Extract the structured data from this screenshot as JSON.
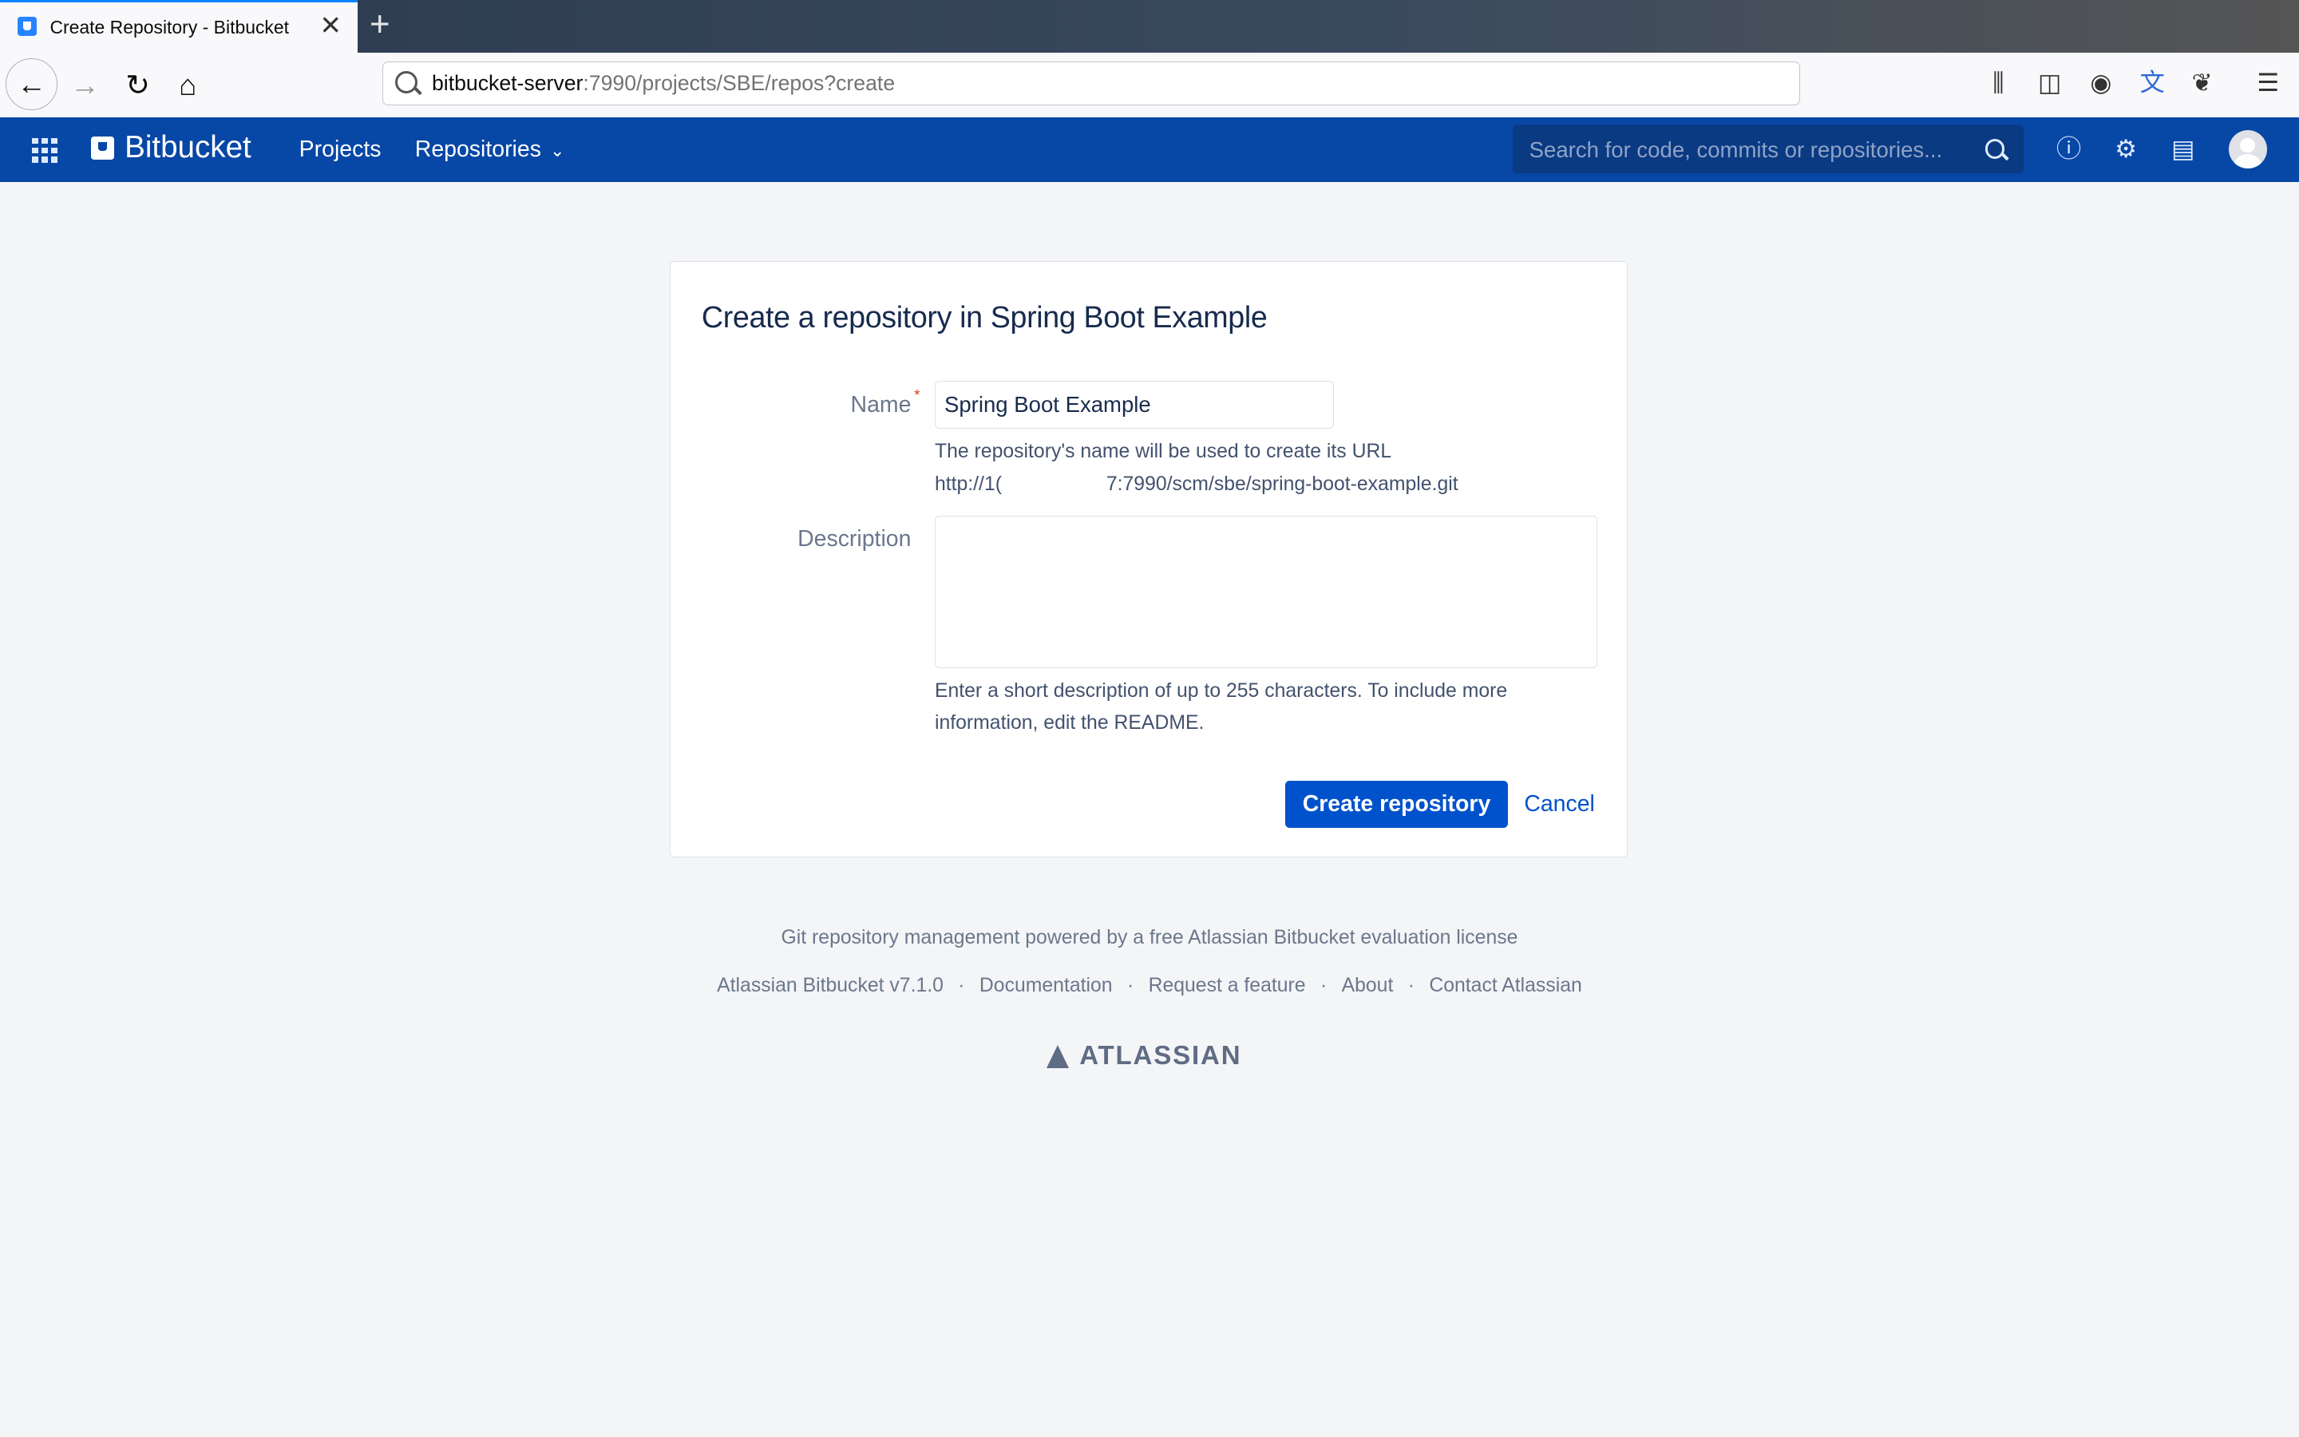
{
  "browser": {
    "tab_title": "Create Repository - Bitbucket",
    "url_host": "bitbucket-server",
    "url_rest": ":7990/projects/SBE/repos?create"
  },
  "appnav": {
    "brand": "Bitbucket",
    "projects": "Projects",
    "repositories": "Repositories",
    "search_placeholder": "Search for code, commits or repositories..."
  },
  "form": {
    "title": "Create a repository in Spring Boot Example",
    "name_label": "Name",
    "name_value": "Spring Boot Example",
    "name_help": "The repository's name will be used to create its URL",
    "url_prefix": "http://1(",
    "url_suffix": "7:7990/scm/sbe/spring-boot-example.git",
    "description_label": "Description",
    "description_value": "",
    "description_help_1": "Enter a short description of up to 255 characters. To include more",
    "description_help_2": "information, edit the README.",
    "create_button": "Create repository",
    "cancel_link": "Cancel"
  },
  "footer": {
    "license": "Git repository management powered by a free Atlassian Bitbucket evaluation license",
    "version": "Atlassian Bitbucket v7.1.0",
    "documentation": "Documentation",
    "request_feature": "Request a feature",
    "about": "About",
    "contact": "Contact Atlassian",
    "atlassian": "ATLASSIAN"
  },
  "colors": {
    "nav_bg": "#0747a6",
    "primary_button": "#0052cc",
    "page_bg": "#f4f5f7"
  }
}
